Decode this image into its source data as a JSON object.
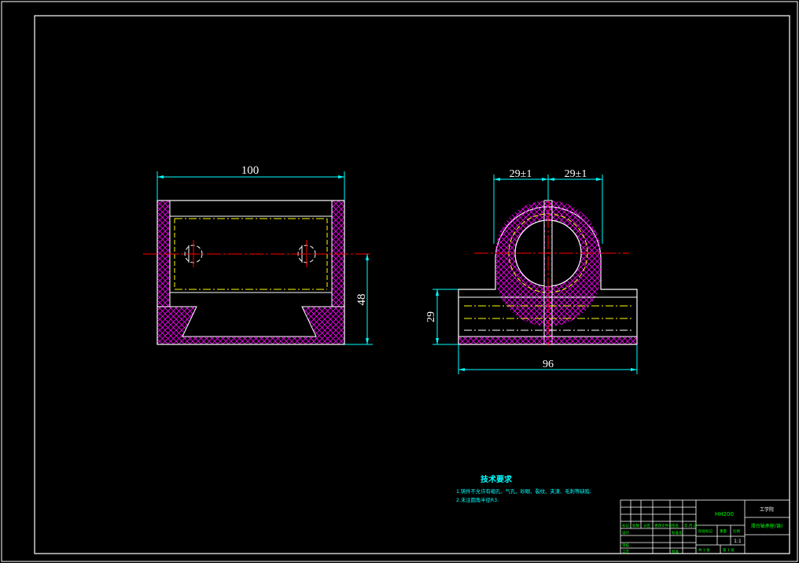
{
  "drawing": {
    "front_view": {
      "width_dim": "100",
      "height_dim": "48"
    },
    "side_view": {
      "left_half_dim": "29±1",
      "right_half_dim": "29±1",
      "height_dim": "29",
      "width_dim": "96"
    }
  },
  "tech_notes": {
    "title": "技术要求",
    "items": [
      "1.铸件不允许有缩孔、气孔、砂眼、裂纹、夹渣、毛刺等缺陷;",
      "2.未注圆角半径R3."
    ]
  },
  "title_block": {
    "code": "HH200",
    "company": "工学院",
    "part_name": "滑台轴承座(铸)",
    "scale": "1:1",
    "labels": {
      "mark": "标记",
      "count": "处数",
      "zone": "分区",
      "change_doc": "更改文件号",
      "signature": "签名",
      "date": "年.月.日",
      "design": "设计",
      "standardize": "标准化",
      "review": "审核",
      "process": "工艺",
      "approve": "批准",
      "stage_mark": "阶段标记",
      "weight": "重量",
      "ratio": "比例",
      "total": "共 1 张",
      "sheet": "第 1 张"
    }
  },
  "colors": {
    "frame": "#ffffff",
    "outline": "#ffffff",
    "hatch": "#ff00ff",
    "hidden": "#ffff00",
    "center": "#ff0000",
    "dimension": "#00ffff",
    "note": "#00ffff",
    "title_green": "#00ff00"
  }
}
